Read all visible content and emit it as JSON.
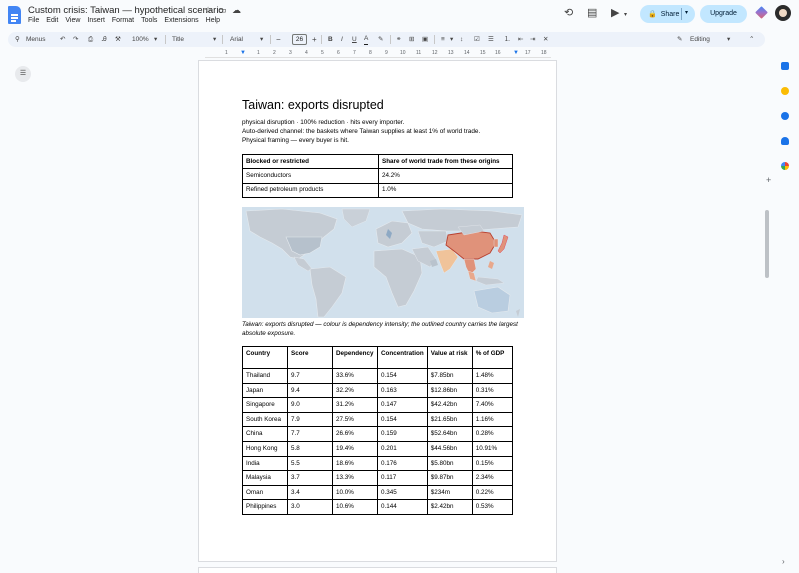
{
  "app": {
    "doc_title": "Custom crisis: Taiwan — hypothetical scenario",
    "menu": [
      "File",
      "Edit",
      "View",
      "Insert",
      "Format",
      "Tools",
      "Extensions",
      "Help"
    ],
    "share_label": "Share",
    "upgrade_label": "Upgrade"
  },
  "toolbar": {
    "menus_label": "Menus",
    "zoom": "100%",
    "style": "Title",
    "font": "Arial",
    "font_size": "26",
    "mode": "Editing"
  },
  "ruler": {
    "numbers": [
      "1",
      "1",
      "2",
      "3",
      "4",
      "5",
      "6",
      "7",
      "8",
      "9",
      "10",
      "11",
      "12",
      "13",
      "14",
      "15",
      "16",
      "17",
      "18"
    ]
  },
  "document": {
    "heading": "Taiwan: exports disrupted",
    "lines": [
      "physical disruption · 100% reduction · hits every importer.",
      "Auto-derived channel: the baskets where Taiwan supplies at least 1% of world trade.",
      "Physical framing — every buyer is hit."
    ],
    "blocked_table": {
      "headers": [
        "Blocked or restricted",
        "Share of world trade from these origins"
      ],
      "rows": [
        [
          "Semiconductors",
          "24.2%"
        ],
        [
          "Refined petroleum products",
          "1.0%"
        ]
      ]
    },
    "caption": "Taiwan: exports disrupted — colour is dependency intensity; the outlined country carries the largest absolute exposure.",
    "exposure_table": {
      "headers": [
        "Country",
        "Score",
        "Dependency",
        "Concentration",
        "Value at risk",
        "% of GDP"
      ],
      "rows": [
        [
          "Thailand",
          "9.7",
          "33.6%",
          "0.154",
          "$7.85bn",
          "1.48%"
        ],
        [
          "Japan",
          "9.4",
          "32.2%",
          "0.163",
          "$12.86bn",
          "0.31%"
        ],
        [
          "Singapore",
          "9.0",
          "31.2%",
          "0.147",
          "$42.42bn",
          "7.40%"
        ],
        [
          "South Korea",
          "7.9",
          "27.5%",
          "0.154",
          "$21.65bn",
          "1.16%"
        ],
        [
          "China",
          "7.7",
          "26.6%",
          "0.159",
          "$52.64bn",
          "0.28%"
        ],
        [
          "Hong Kong",
          "5.8",
          "19.4%",
          "0.201",
          "$44.56bn",
          "10.91%"
        ],
        [
          "India",
          "5.5",
          "18.6%",
          "0.176",
          "$5.80bn",
          "0.15%"
        ],
        [
          "Malaysia",
          "3.7",
          "13.3%",
          "0.117",
          "$9.87bn",
          "2.34%"
        ],
        [
          "Oman",
          "3.4",
          "10.0%",
          "0.345",
          "$234m",
          "0.22%"
        ],
        [
          "Philippines",
          "3.0",
          "10.6%",
          "0.144",
          "$2.42bn",
          "0.53%"
        ]
      ]
    }
  },
  "colors": {
    "accent": "#1a73e8",
    "share_bg": "#c2e7ff",
    "map_ocean": "#d1e0ec",
    "map_land": "#c5ccd4",
    "map_high": "#e0927a",
    "map_mid": "#f0c39a"
  }
}
